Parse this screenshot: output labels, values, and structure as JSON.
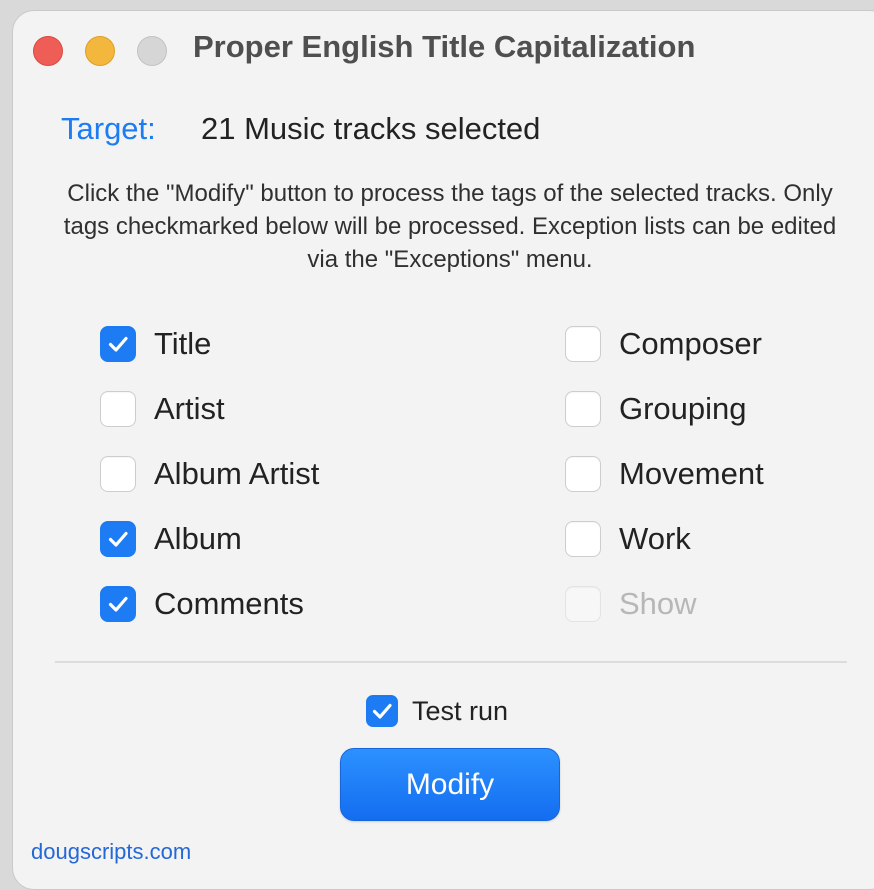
{
  "window": {
    "title": "Proper English Title Capitalization",
    "traffic_lights": [
      {
        "name": "close",
        "color": "#ee5e57"
      },
      {
        "name": "minimize",
        "color": "#f3b73d"
      },
      {
        "name": "zoom",
        "color": "#d6d6d6"
      }
    ]
  },
  "target": {
    "label": "Target:",
    "value": "21 Music tracks selected"
  },
  "instructions": "Click the \"Modify\" button to process the tags of the selected tracks. Only tags checkmarked below will be processed. Exception lists can be edited via the \"Exceptions\" menu.",
  "left_options": [
    {
      "label": "Title",
      "checked": true
    },
    {
      "label": "Artist",
      "checked": false
    },
    {
      "label": "Album Artist",
      "checked": false
    },
    {
      "label": "Album",
      "checked": true
    },
    {
      "label": "Comments",
      "checked": true
    }
  ],
  "right_options": [
    {
      "label": "Composer",
      "checked": false
    },
    {
      "label": "Grouping",
      "checked": false
    },
    {
      "label": "Movement",
      "checked": false
    },
    {
      "label": "Work",
      "checked": false
    },
    {
      "label": "Show",
      "checked": false,
      "disabled": true
    }
  ],
  "test_run": {
    "label": "Test run",
    "checked": true
  },
  "modify_button": {
    "label": "Modify"
  },
  "footer": {
    "link_text": "dougscripts.com"
  },
  "colors": {
    "accent": "#1d7cf4",
    "target_label": "#1c7cf3",
    "link": "#2468d6"
  }
}
